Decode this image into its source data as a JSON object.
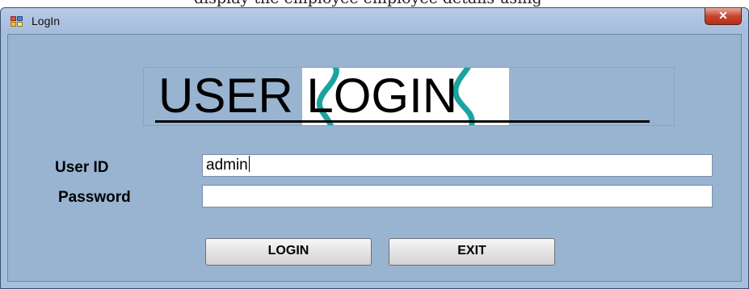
{
  "document": {
    "fragment_text": "display the employee employee details using"
  },
  "window": {
    "title": "LogIn",
    "close_glyph": "✕"
  },
  "banner": {
    "text": "USER LOGIN"
  },
  "form": {
    "user_id_label": "User ID",
    "user_id_value": "admin",
    "password_label": "Password",
    "password_value": ""
  },
  "buttons": {
    "login_label": "LOGIN",
    "exit_label": "EXIT"
  },
  "icons": {
    "app": "app-window-icon",
    "close": "close-icon"
  },
  "colors": {
    "client_background": "#99b4d1",
    "titlebar": "#a4bede",
    "close_button": "#c9442f",
    "swirl": "#1aa3a0"
  }
}
